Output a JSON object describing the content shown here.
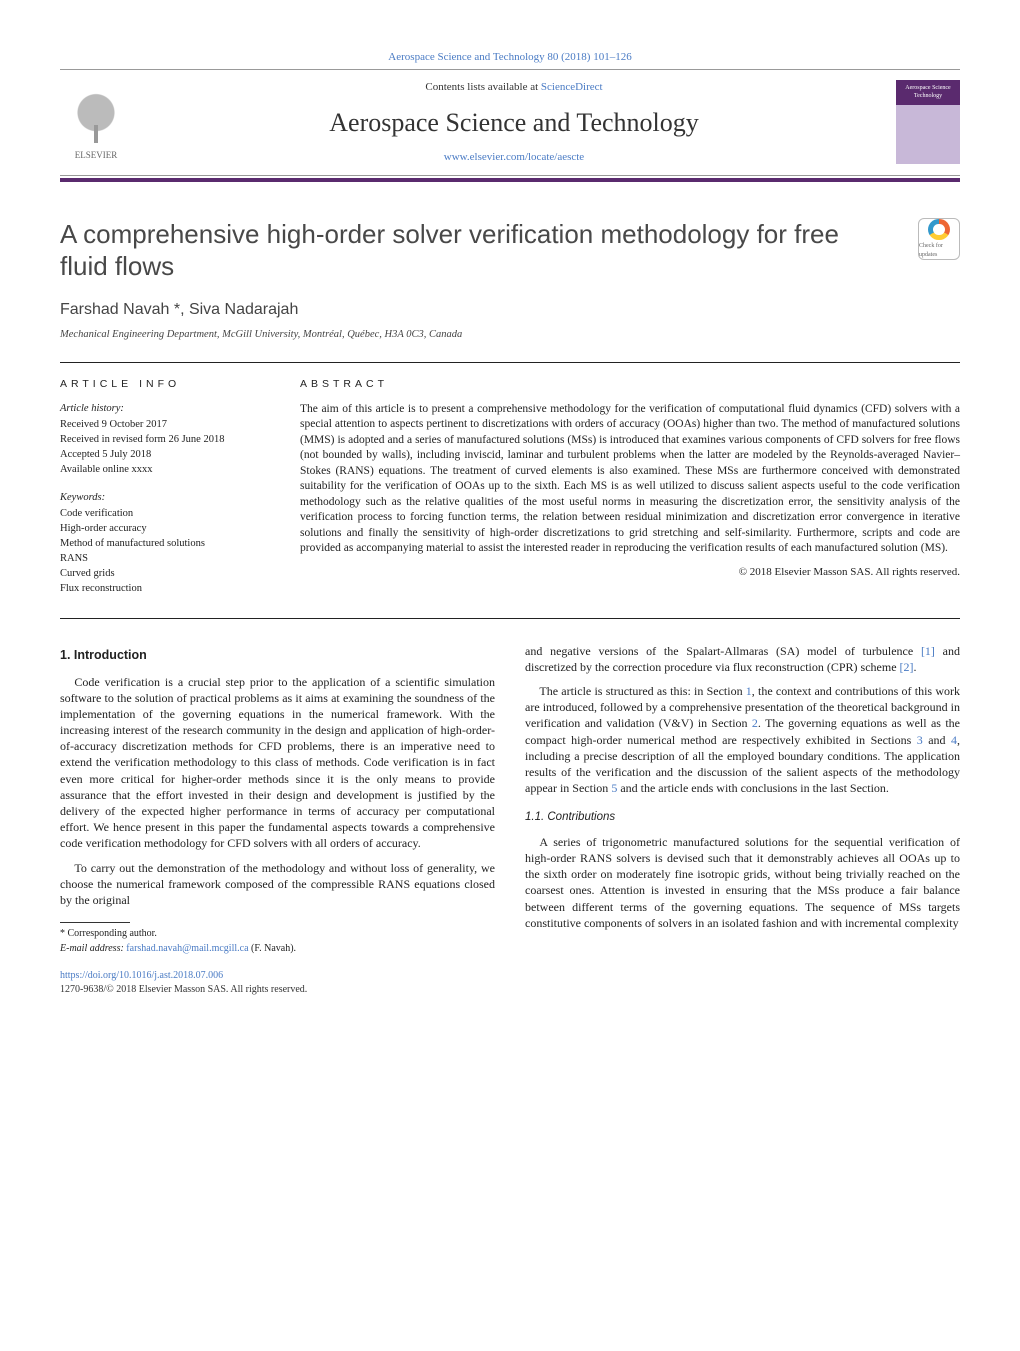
{
  "journal": {
    "citation": "Aerospace Science and Technology 80 (2018) 101–126",
    "contents_prefix": "Contents lists available at ",
    "contents_link": "ScienceDirect",
    "name": "Aerospace Science and Technology",
    "homepage": "www.elsevier.com/locate/aescte",
    "publisher_logo_label": "ELSEVIER",
    "cover_label": "Aerospace Science Technology"
  },
  "article": {
    "title": "A comprehensive high-order solver verification methodology for free fluid flows",
    "authors": "Farshad Navah *, Siva Nadarajah",
    "affiliation": "Mechanical Engineering Department, McGill University, Montréal, Québec, H3A 0C3, Canada",
    "crossmark_label": "Check for updates"
  },
  "info": {
    "heading": "ARTICLE INFO",
    "history_label": "Article history:",
    "history": [
      "Received 9 October 2017",
      "Received in revised form 26 June 2018",
      "Accepted 5 July 2018",
      "Available online xxxx"
    ],
    "keywords_label": "Keywords:",
    "keywords": [
      "Code verification",
      "High-order accuracy",
      "Method of manufactured solutions",
      "RANS",
      "Curved grids",
      "Flux reconstruction"
    ]
  },
  "abstract": {
    "heading": "ABSTRACT",
    "text": "The aim of this article is to present a comprehensive methodology for the verification of computational fluid dynamics (CFD) solvers with a special attention to aspects pertinent to discretizations with orders of accuracy (OOAs) higher than two. The method of manufactured solutions (MMS) is adopted and a series of manufactured solutions (MSs) is introduced that examines various components of CFD solvers for free flows (not bounded by walls), including inviscid, laminar and turbulent problems when the latter are modeled by the Reynolds-averaged Navier–Stokes (RANS) equations. The treatment of curved elements is also examined. These MSs are furthermore conceived with demonstrated suitability for the verification of OOAs up to the sixth. Each MS is as well utilized to discuss salient aspects useful to the code verification methodology such as the relative qualities of the most useful norms in measuring the discretization error, the sensitivity analysis of the verification process to forcing function terms, the relation between residual minimization and discretization error convergence in iterative solutions and finally the sensitivity of high-order discretizations to grid stretching and self-similarity. Furthermore, scripts and code are provided as accompanying material to assist the interested reader in reproducing the verification results of each manufactured solution (MS).",
    "copyright": "© 2018 Elsevier Masson SAS. All rights reserved."
  },
  "body": {
    "section1_heading": "1. Introduction",
    "para1": "Code verification is a crucial step prior to the application of a scientific simulation software to the solution of practical problems as it aims at examining the soundness of the implementation of the governing equations in the numerical framework. With the increasing interest of the research community in the design and application of high-order-of-accuracy discretization methods for CFD problems, there is an imperative need to extend the verification methodology to this class of methods. Code verification is in fact even more critical for higher-order methods since it is the only means to provide assurance that the effort invested in their design and development is justified by the delivery of the expected higher performance in terms of accuracy per computational effort. We hence present in this paper the fundamental aspects towards a comprehensive code verification methodology for CFD solvers with all orders of accuracy.",
    "para2": "To carry out the demonstration of the methodology and without loss of generality, we choose the numerical framework composed of the compressible RANS equations closed by the original",
    "para3_a": "and negative versions of the Spalart-Allmaras (SA) model of turbulence ",
    "ref1": "[1]",
    "para3_b": " and discretized by the correction procedure via flux reconstruction (CPR) scheme ",
    "ref2": "[2]",
    "para3_c": ".",
    "para4_a": "The article is structured as this: in Section ",
    "refS1": "1",
    "para4_b": ", the context and contributions of this work are introduced, followed by a comprehensive presentation of the theoretical background in verification and validation (V&V) in Section ",
    "refS2": "2",
    "para4_c": ". The governing equations as well as the compact high-order numerical method are respectively exhibited in Sections ",
    "refS3": "3",
    "para4_d": " and ",
    "refS4": "4",
    "para4_e": ", including a precise description of all the employed boundary conditions. The application results of the verification and the discussion of the salient aspects of the methodology appear in Section ",
    "refS5": "5",
    "para4_f": " and the article ends with conclusions in the last Section.",
    "section11_heading": "1.1. Contributions",
    "para5": "A series of trigonometric manufactured solutions for the sequential verification of high-order RANS solvers is devised such that it demonstrably achieves all OOAs up to the sixth order on moderately fine isotropic grids, without being trivially reached on the coarsest ones. Attention is invested in ensuring that the MSs produce a fair balance between different terms of the governing equations. The sequence of MSs targets constitutive components of solvers in an isolated fashion and with incremental complexity"
  },
  "footnotes": {
    "corr_label": "* Corresponding author.",
    "email_label": "E-mail address:",
    "email": "farshad.navah@mail.mcgill.ca",
    "email_person": " (F. Navah)."
  },
  "footer": {
    "doi": "https://doi.org/10.1016/j.ast.2018.07.006",
    "issn_line": "1270-9638/© 2018 Elsevier Masson SAS. All rights reserved."
  }
}
